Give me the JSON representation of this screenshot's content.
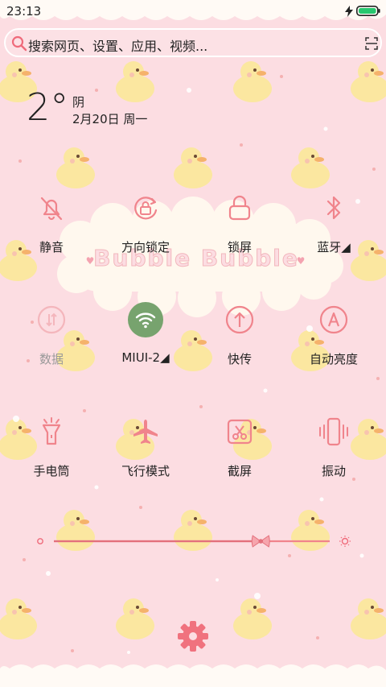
{
  "status_bar": {
    "time": "23:13",
    "battery_icon": "battery-icon",
    "charging_icon": "bolt-icon"
  },
  "search": {
    "placeholder": "搜索网页、设置、应用、视频...",
    "scan_icon": "scan-icon"
  },
  "weather": {
    "temperature": "2°",
    "condition": "阴",
    "date": "2月20日 周一"
  },
  "background": {
    "decoration_text": "Bubble Bubble"
  },
  "toggles": [
    {
      "label": "静音",
      "icon": "bell-off-icon",
      "active": false
    },
    {
      "label": "方向锁定",
      "icon": "rotation-lock-icon",
      "active": false
    },
    {
      "label": "锁屏",
      "icon": "lock-icon",
      "active": false
    },
    {
      "label": "蓝牙◢",
      "icon": "bluetooth-icon",
      "active": false
    },
    {
      "label": "数据",
      "icon": "mobile-data-icon",
      "active": false,
      "disabled": true
    },
    {
      "label": "MIUI-2◢",
      "icon": "wifi-icon",
      "active": true
    },
    {
      "label": "快传",
      "icon": "transfer-icon",
      "active": false
    },
    {
      "label": "自动亮度",
      "icon": "auto-brightness-icon",
      "active": false
    },
    {
      "label": "手电筒",
      "icon": "flashlight-icon",
      "active": false
    },
    {
      "label": "飞行模式",
      "icon": "airplane-icon",
      "active": false
    },
    {
      "label": "截屏",
      "icon": "screenshot-icon",
      "active": false
    },
    {
      "label": "振动",
      "icon": "vibrate-icon",
      "active": false
    }
  ],
  "brightness": {
    "level": 0.75,
    "min_icon": "brightness-low-icon",
    "max_icon": "brightness-high-icon",
    "thumb_icon": "bow-icon"
  },
  "settings": {
    "icon": "gear-icon"
  },
  "colors": {
    "background": "#fcdde2",
    "accent": "#f0848c",
    "wifi_active": "#77a36e",
    "text": "#222222"
  }
}
